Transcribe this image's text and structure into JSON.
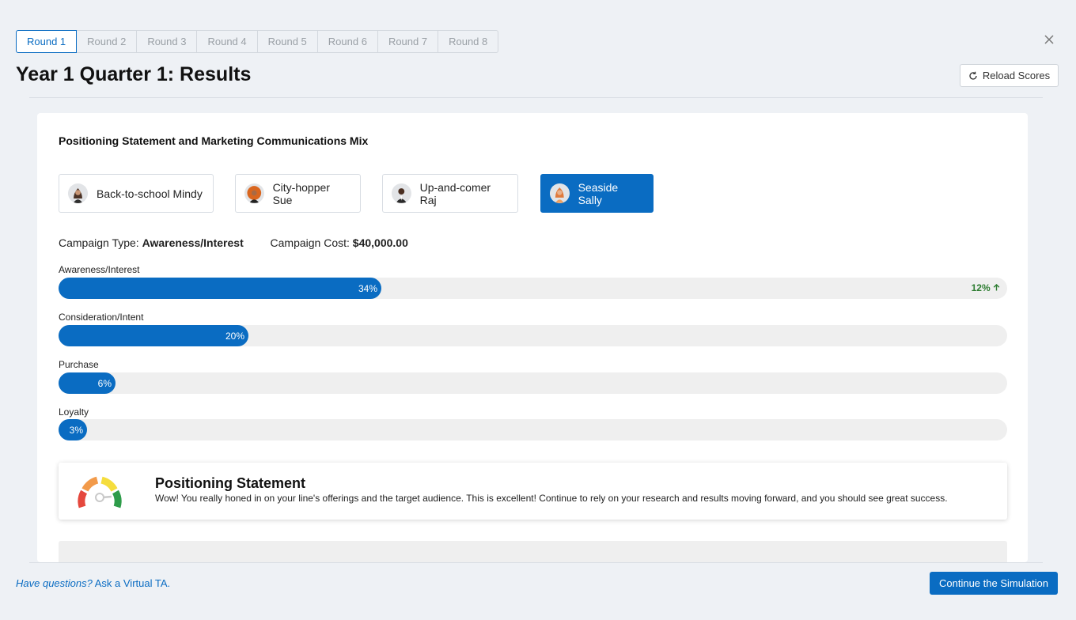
{
  "rounds": [
    "Round 1",
    "Round 2",
    "Round 3",
    "Round 4",
    "Round 5",
    "Round 6",
    "Round 7",
    "Round 8"
  ],
  "header": {
    "title": "Year 1 Quarter 1: Results",
    "reload_label": "Reload Scores"
  },
  "card": {
    "section_title": "Positioning Statement and Marketing Communications Mix",
    "personas": [
      {
        "label": "Back-to-school Mindy",
        "active": false
      },
      {
        "label": "City-hopper Sue",
        "active": false
      },
      {
        "label": "Up-and-comer Raj",
        "active": false
      },
      {
        "label": "Seaside Sally",
        "active": true
      }
    ],
    "campaign_type_label": "Campaign Type:",
    "campaign_type_value": "Awareness/Interest",
    "campaign_cost_label": "Campaign Cost:",
    "campaign_cost_value": "$40,000.00",
    "bars": [
      {
        "label": "Awareness/Interest",
        "percent": 34,
        "display": "34%",
        "change": "12%"
      },
      {
        "label": "Consideration/Intent",
        "percent": 20,
        "display": "20%"
      },
      {
        "label": "Purchase",
        "percent": 6,
        "display": "6%"
      },
      {
        "label": "Loyalty",
        "percent": 3,
        "display": "3%"
      }
    ],
    "feedback": {
      "title": "Positioning Statement",
      "text": "Wow! You really honed in on your line's offerings and the target audience. This is excellent! Continue to rely on your research and results moving forward, and you should see great success."
    }
  },
  "footer": {
    "help_italic": "Have questions?",
    "help_rest": "Ask a Virtual TA.",
    "continue_label": "Continue the Simulation"
  },
  "colors": {
    "accent": "#0a6cc2",
    "positive": "#2e7d32"
  }
}
